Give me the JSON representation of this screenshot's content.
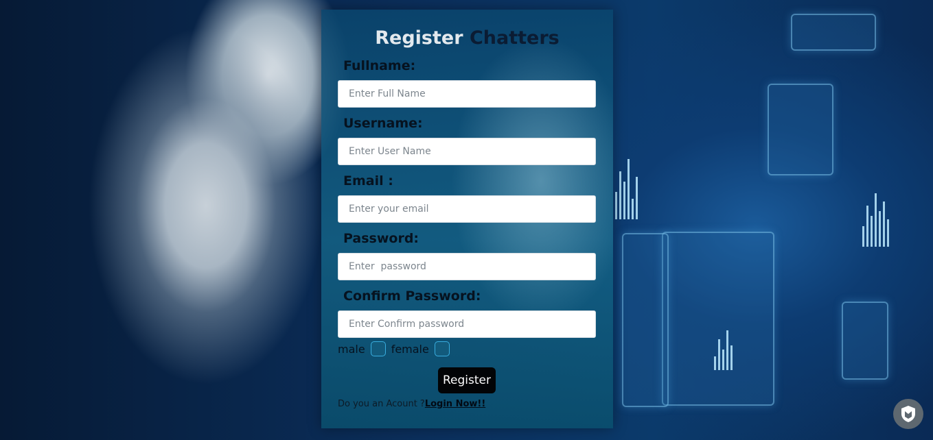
{
  "form": {
    "title_part1": "Register",
    "title_part2": "Chatters",
    "fields": [
      {
        "label": "Fullname:",
        "placeholder": "Enter Full Name",
        "value": ""
      },
      {
        "label": "Username:",
        "placeholder": "Enter User Name",
        "value": ""
      },
      {
        "label": "Email :",
        "placeholder": "Enter your email",
        "value": ""
      },
      {
        "label": "Password:",
        "placeholder": "Enter  password",
        "value": ""
      },
      {
        "label": "Confirm Password:",
        "placeholder": "Enter Confirm password",
        "value": ""
      }
    ],
    "gender": {
      "male_label": "male",
      "female_label": "female"
    },
    "register_button": "Register",
    "login_prompt": "Do you an Acount ?",
    "login_link": "Login Now!!"
  },
  "colors": {
    "title_light": "#e3e9ee",
    "title_dark": "#0b1c33",
    "button_bg": "#020406",
    "radio_border": "#39aee0"
  },
  "icons": {
    "badge": "shield-icon"
  }
}
